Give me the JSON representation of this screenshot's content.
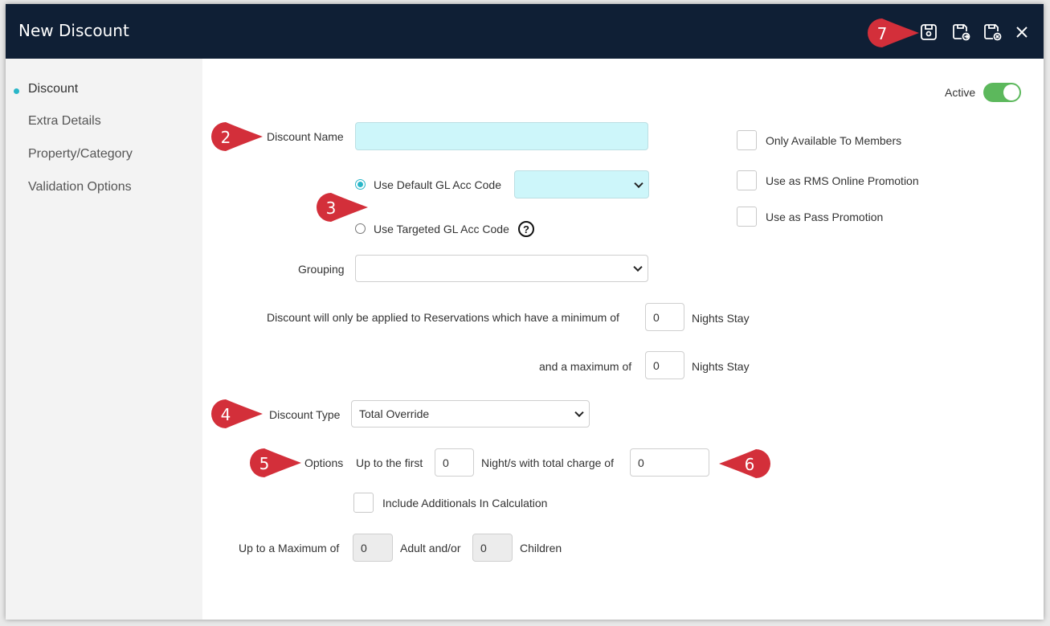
{
  "window": {
    "title": "New Discount"
  },
  "toolbar": {
    "save_icon": "save-icon",
    "save_and_new_icon": "save-and-new-icon",
    "save_and_close_icon": "save-and-close-icon",
    "close_icon": "close-icon"
  },
  "sidebar": {
    "items": [
      {
        "label": "Discount",
        "active": true
      },
      {
        "label": "Extra Details"
      },
      {
        "label": "Property/Category"
      },
      {
        "label": "Validation Options"
      }
    ]
  },
  "form": {
    "active_label": "Active",
    "active_on": true,
    "discount_name_label": "Discount Name",
    "discount_name_value": "",
    "default_gl_label": "Use Default GL Acc Code",
    "default_gl_value": "",
    "targeted_gl_label": "Use Targeted GL Acc Code",
    "help_glyph": "?",
    "grouping_label": "Grouping",
    "grouping_value": "",
    "min_nights_label": "Discount will only be applied to Reservations which have a minimum of",
    "min_nights_value": "0",
    "max_nights_label": "and a maximum of",
    "max_nights_value": "0",
    "nights_stay_label": "Nights Stay",
    "discount_type_label": "Discount Type",
    "discount_type_value": "Total Override",
    "options_label": "Options",
    "up_to_first_label": "Up to the first",
    "up_to_first_value": "0",
    "nights_total_charge_label": "Night/s with total charge of",
    "total_charge_value": "0",
    "include_additionals_label": "Include Additionals In Calculation",
    "max_label": "Up to a Maximum of",
    "adults_value": "0",
    "adult_andor_label": "Adult and/or",
    "children_value": "0",
    "children_label": "Children",
    "members_label": "Only Available To Members",
    "rms_promo_label": "Use as RMS Online Promotion",
    "pass_promo_label": "Use as Pass Promotion"
  },
  "markers": [
    "2",
    "3",
    "4",
    "5",
    "6",
    "7"
  ],
  "colors": {
    "titlebar": "#0f1f35",
    "accent": "#29b6c8",
    "marker": "#d32f3a",
    "toggle": "#5cb85c"
  }
}
